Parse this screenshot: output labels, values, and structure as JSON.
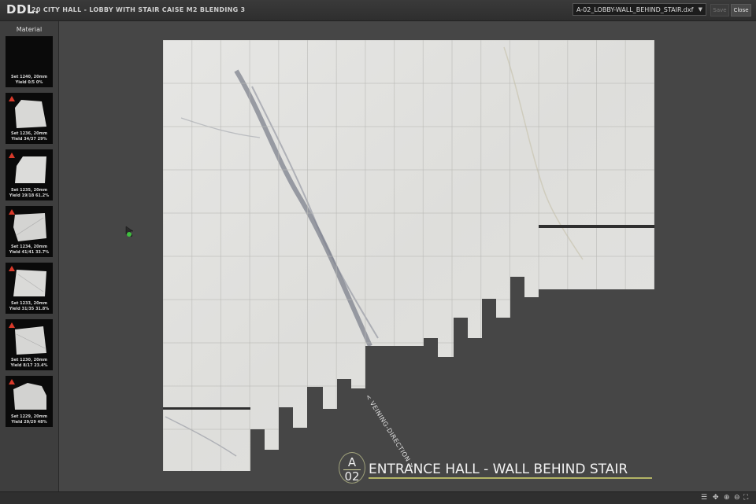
{
  "header": {
    "logo": "DDL.",
    "project_title": "20 CITY HALL - LOBBY WITH STAIR CAISE M2 BLENDING 3",
    "file_select": "A-02_LOBBY-WALL_BEHIND_STAIR.dxf",
    "save_label": "Save",
    "close_label": "Close"
  },
  "sidebar": {
    "title": "Material",
    "slabs": [
      {
        "line1": "Set 1240, 20mm",
        "line2": "Yield 0/5 0%",
        "warning": false
      },
      {
        "line1": "Set 1236, 20mm",
        "line2": "Yield 34/37 29%",
        "warning": true
      },
      {
        "line1": "Set 1235, 20mm",
        "line2": "Yield 19/18 61.2%",
        "warning": true
      },
      {
        "line1": "Set 1234, 20mm",
        "line2": "Yield 41/41 33.7%",
        "warning": true
      },
      {
        "line1": "Set 1233, 20mm",
        "line2": "Yield 31/35 31.8%",
        "warning": true
      },
      {
        "line1": "Set 1230, 20mm",
        "line2": "Yield 8/17 23.4%",
        "warning": true
      },
      {
        "line1": "Set 1229, 20mm",
        "line2": "Yield 29/29 48%",
        "warning": true
      }
    ]
  },
  "drawing": {
    "veining_label": "< VEINING-DIRECTION >",
    "sheet_letter": "A",
    "sheet_number": "02",
    "sheet_title": "ENTRANCE HALL - WALL  BEHIND STAIR"
  },
  "colors": {
    "marble": "#e4e4e2",
    "vein": "#5a5f70",
    "background": "#464646",
    "warning": "#d93a2a",
    "title_accent": "#b3b566"
  },
  "footer_icons": [
    "menu-icon",
    "move-icon",
    "zoom-in-icon",
    "zoom-out-icon",
    "zoom-fit-icon",
    "fullscreen-icon"
  ]
}
